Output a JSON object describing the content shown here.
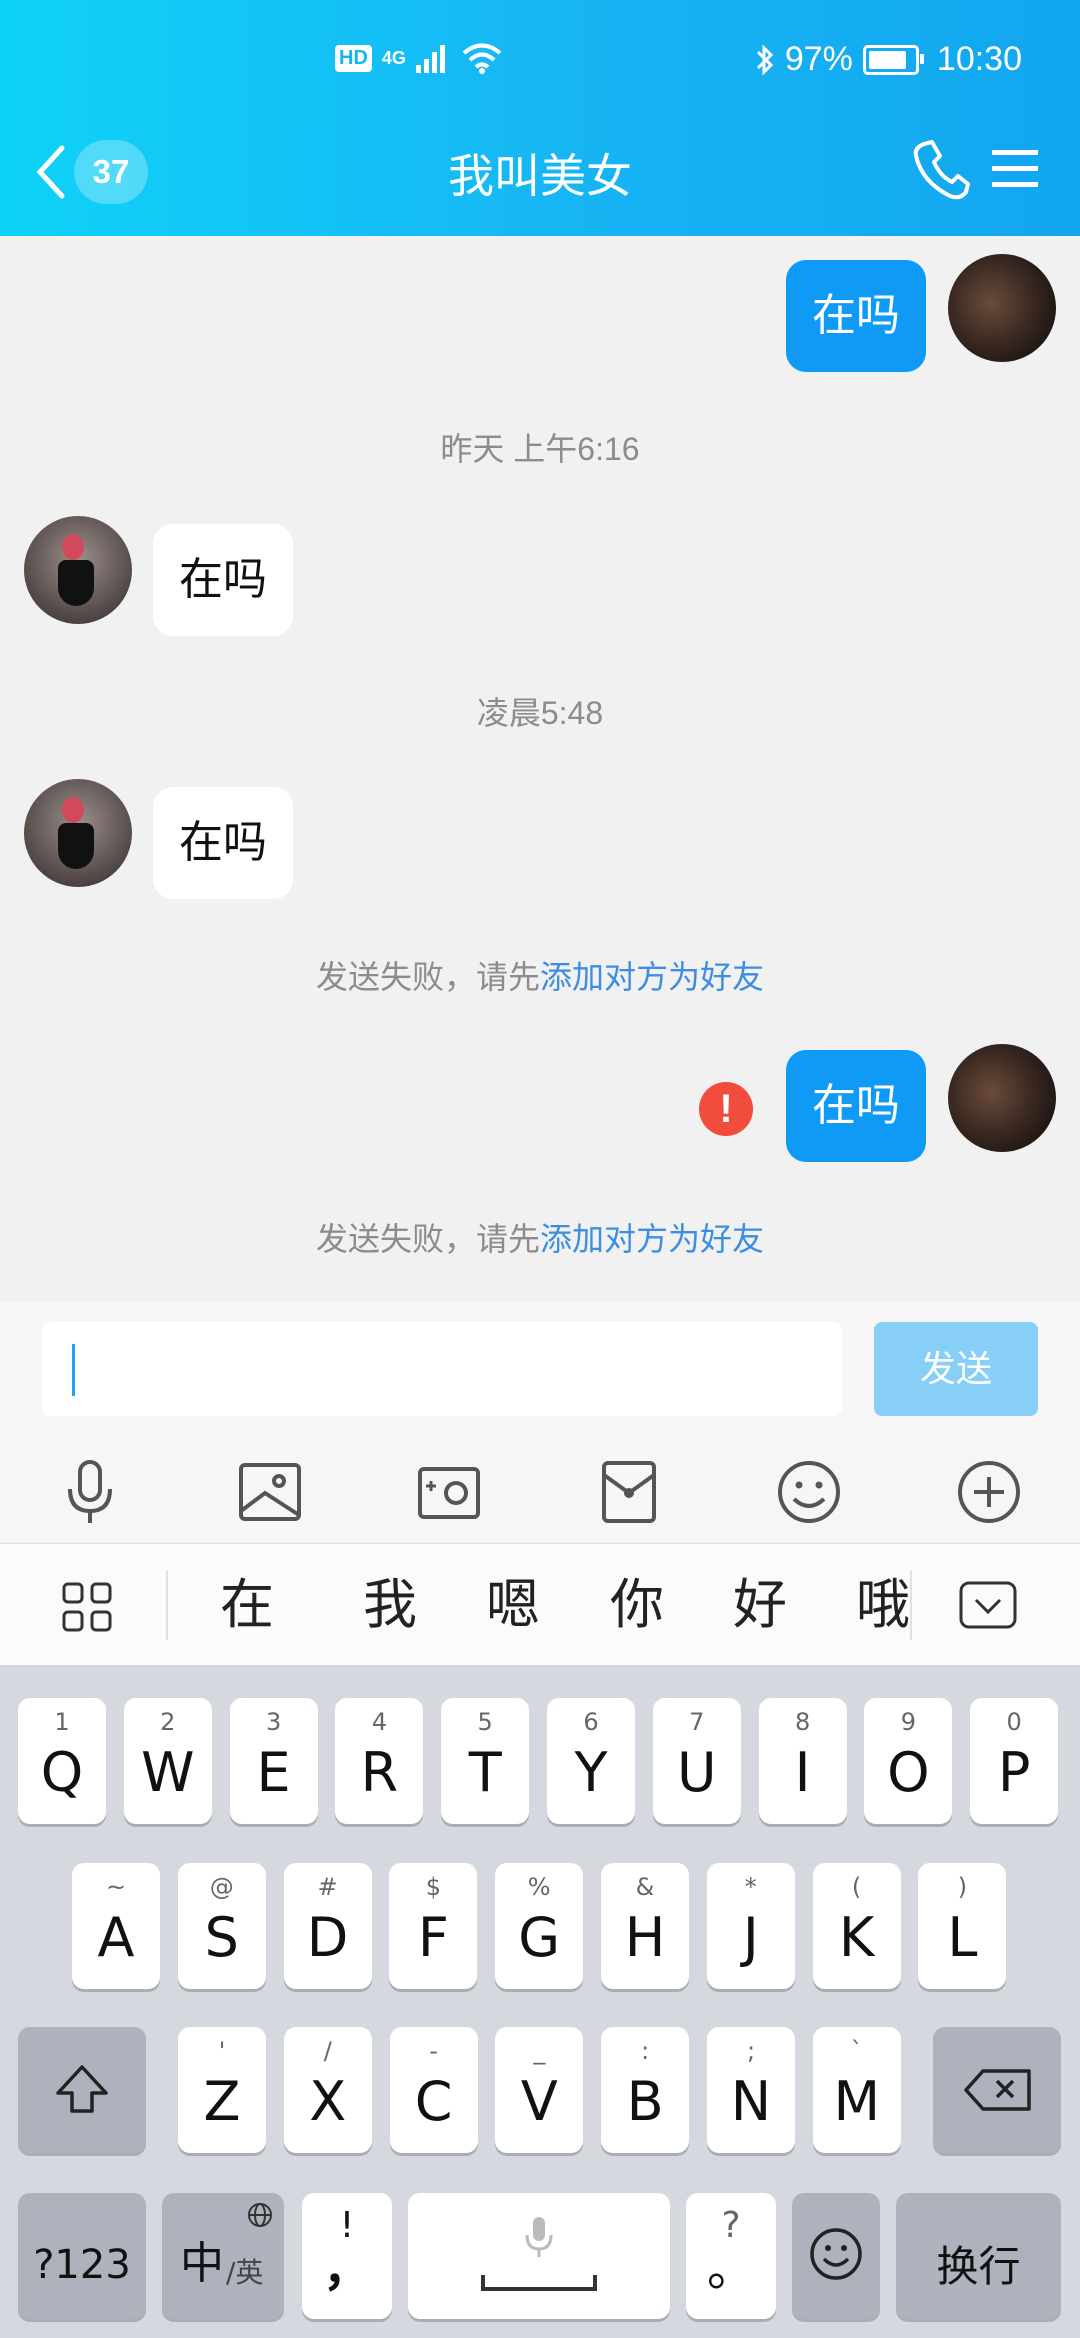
{
  "status_bar": {
    "hd": "HD",
    "network": "4G",
    "battery": "97%",
    "battery_level": 0.97,
    "time": "10:30"
  },
  "nav": {
    "unread_count": "37",
    "title": "我叫美女"
  },
  "messages": [
    {
      "from": "me",
      "text": "在吗"
    },
    {
      "type": "time",
      "text": "昨天 上午6:16"
    },
    {
      "from": "her",
      "text": "在吗"
    },
    {
      "type": "time",
      "text": "凌晨5:48"
    },
    {
      "from": "her",
      "text": "在吗"
    },
    {
      "type": "notice",
      "prefix": "发送失败，请先",
      "link": "添加对方为好友"
    },
    {
      "from": "me",
      "text": "在吗",
      "error_icon": "!"
    },
    {
      "type": "notice",
      "prefix": "发送失败，请先",
      "link": "添加对方为好友"
    }
  ],
  "composer": {
    "input_value": "",
    "send_label": "发送"
  },
  "toolbar_icons": [
    "microphone-icon",
    "image-icon",
    "camera-icon",
    "red-packet-icon",
    "emoji-icon",
    "plus-icon"
  ],
  "candidates": [
    "在",
    "我",
    "嗯",
    "你",
    "好",
    "哦"
  ],
  "keyboard": {
    "row1": [
      {
        "sub": "1",
        "main": "Q"
      },
      {
        "sub": "2",
        "main": "W"
      },
      {
        "sub": "3",
        "main": "E"
      },
      {
        "sub": "4",
        "main": "R"
      },
      {
        "sub": "5",
        "main": "T"
      },
      {
        "sub": "6",
        "main": "Y"
      },
      {
        "sub": "7",
        "main": "U"
      },
      {
        "sub": "8",
        "main": "I"
      },
      {
        "sub": "9",
        "main": "O"
      },
      {
        "sub": "0",
        "main": "P"
      }
    ],
    "row2": [
      {
        "sub": "~",
        "main": "A"
      },
      {
        "sub": "@",
        "main": "S"
      },
      {
        "sub": "#",
        "main": "D"
      },
      {
        "sub": "$",
        "main": "F"
      },
      {
        "sub": "%",
        "main": "G"
      },
      {
        "sub": "&",
        "main": "H"
      },
      {
        "sub": "*",
        "main": "J"
      },
      {
        "sub": "(",
        "main": "K"
      },
      {
        "sub": ")",
        "main": "L"
      }
    ],
    "row3": [
      {
        "sub": "'",
        "main": "Z"
      },
      {
        "sub": "/",
        "main": "X"
      },
      {
        "sub": "-",
        "main": "C"
      },
      {
        "sub": "_",
        "main": "V"
      },
      {
        "sub": ":",
        "main": "B"
      },
      {
        "sub": ";",
        "main": "N"
      },
      {
        "sub": "`",
        "main": "M"
      }
    ],
    "symbols_label": "?123",
    "lang_main": "中",
    "lang_sub": "/英",
    "comma_sub": "!",
    "comma_main": "，",
    "period_sub": "?",
    "period_main": "。",
    "enter_label": "换行"
  }
}
